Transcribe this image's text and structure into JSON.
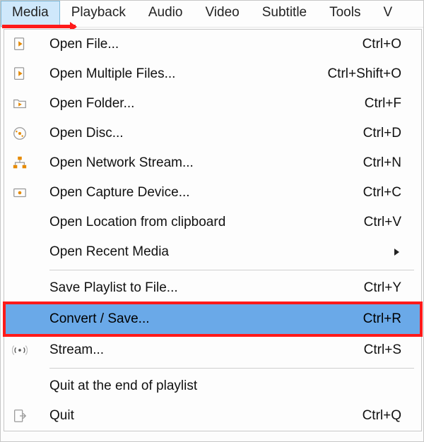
{
  "menubar": {
    "items": [
      {
        "label": "Media",
        "open": true
      },
      {
        "label": "Playback",
        "open": false
      },
      {
        "label": "Audio",
        "open": false
      },
      {
        "label": "Video",
        "open": false
      },
      {
        "label": "Subtitle",
        "open": false
      },
      {
        "label": "Tools",
        "open": false
      },
      {
        "label": "V",
        "open": false
      }
    ]
  },
  "media_menu": {
    "items": [
      {
        "id": "open-file",
        "label": "Open File...",
        "shortcut": "Ctrl+O",
        "icon": "file-play-icon"
      },
      {
        "id": "open-multi",
        "label": "Open Multiple Files...",
        "shortcut": "Ctrl+Shift+O",
        "icon": "file-play-icon"
      },
      {
        "id": "open-folder",
        "label": "Open Folder...",
        "shortcut": "Ctrl+F",
        "icon": "folder-play-icon"
      },
      {
        "id": "open-disc",
        "label": "Open Disc...",
        "shortcut": "Ctrl+D",
        "icon": "disc-icon"
      },
      {
        "id": "open-network",
        "label": "Open Network Stream...",
        "shortcut": "Ctrl+N",
        "icon": "network-icon"
      },
      {
        "id": "open-capture",
        "label": "Open Capture Device...",
        "shortcut": "Ctrl+C",
        "icon": "capture-icon"
      },
      {
        "id": "open-clipboard",
        "label": "Open Location from clipboard",
        "shortcut": "Ctrl+V",
        "icon": ""
      },
      {
        "id": "open-recent",
        "label": "Open Recent Media",
        "submenu": true,
        "icon": ""
      },
      {
        "sep": true
      },
      {
        "id": "save-playlist",
        "label": "Save Playlist to File...",
        "shortcut": "Ctrl+Y",
        "icon": ""
      },
      {
        "id": "convert-save",
        "label": "Convert / Save...",
        "shortcut": "Ctrl+R",
        "icon": "",
        "highlight": true
      },
      {
        "id": "stream",
        "label": "Stream...",
        "shortcut": "Ctrl+S",
        "icon": "stream-icon"
      },
      {
        "sep": true
      },
      {
        "id": "quit-end",
        "label": "Quit at the end of playlist",
        "shortcut": "",
        "icon": ""
      },
      {
        "id": "quit",
        "label": "Quit",
        "shortcut": "Ctrl+Q",
        "icon": "quit-icon"
      }
    ]
  },
  "icons": {
    "file-play-icon": "file-play",
    "folder-play-icon": "folder-play",
    "disc-icon": "disc",
    "network-icon": "network",
    "capture-icon": "capture",
    "stream-icon": "stream",
    "quit-icon": "quit"
  },
  "colors": {
    "highlight_bg": "#6aa9e8",
    "annotation_red": "#ff1a1a",
    "menubar_open_bg": "#cfe8fb"
  }
}
